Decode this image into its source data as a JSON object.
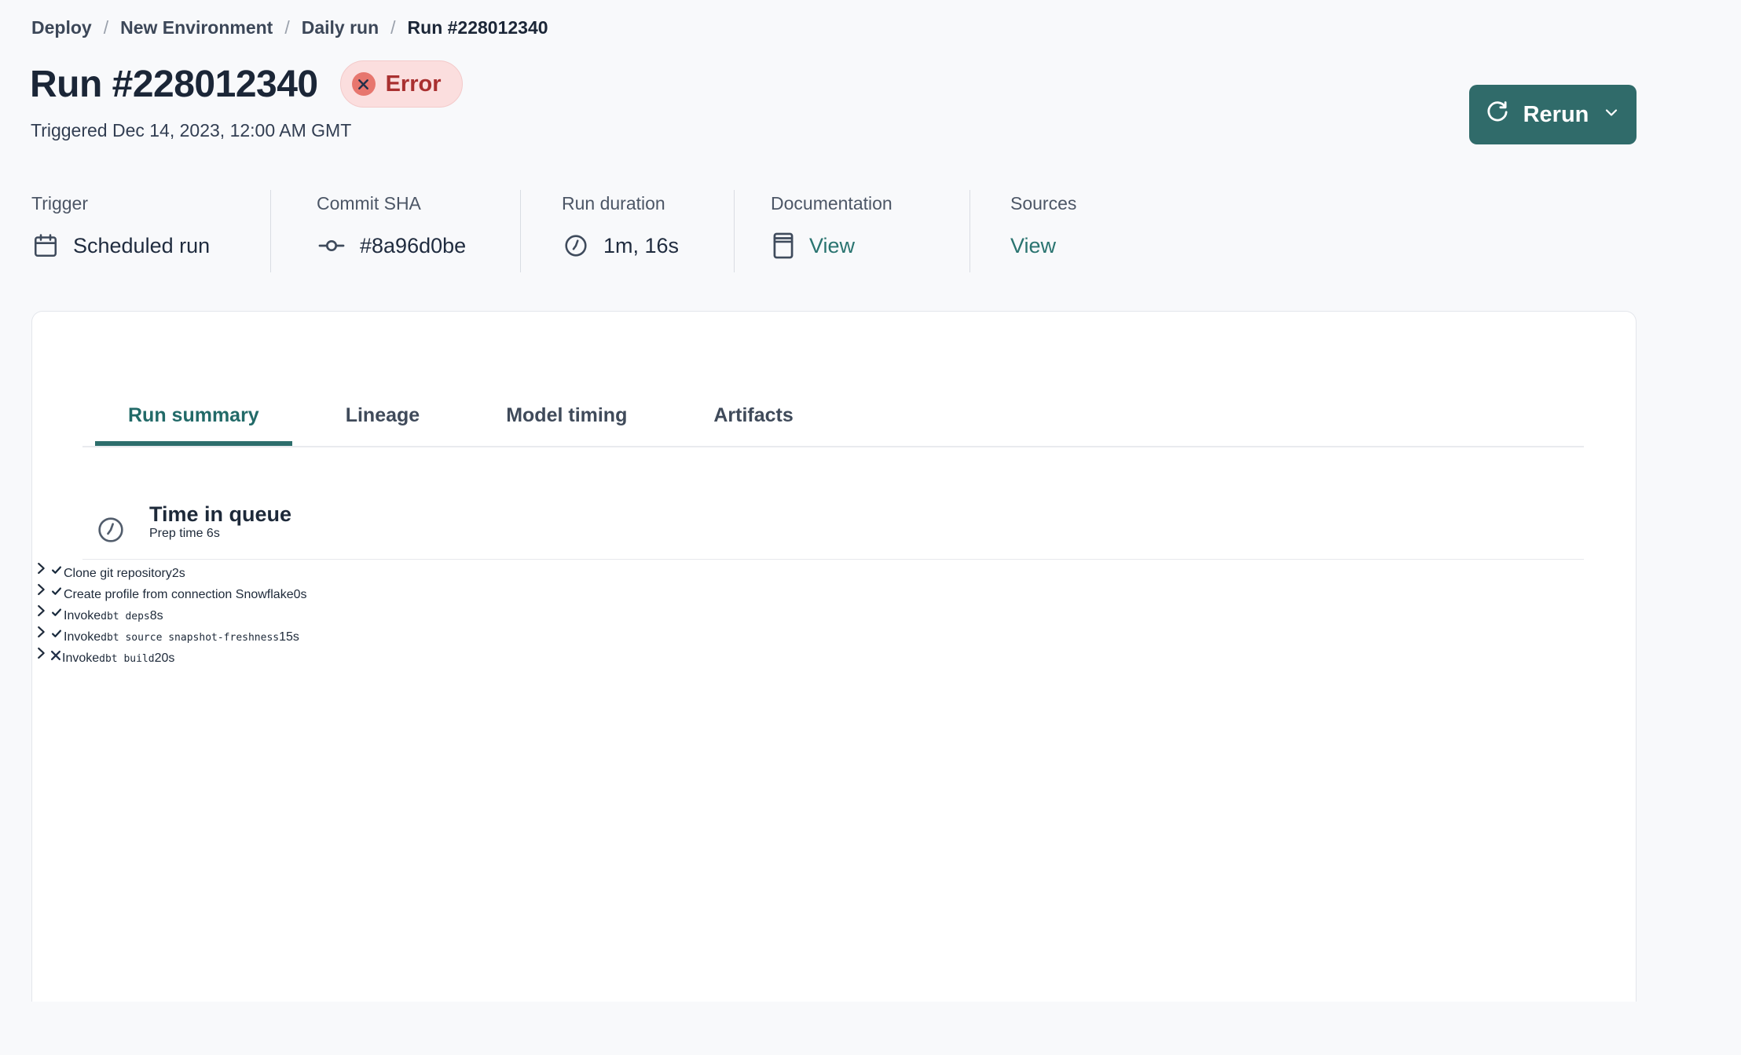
{
  "breadcrumb": {
    "separator": "/",
    "items": [
      "Deploy",
      "New Environment",
      "Daily run",
      "Run #228012340"
    ]
  },
  "header": {
    "title": "Run #228012340",
    "status_badge": {
      "label": "Error",
      "icon": "x-circle-icon"
    },
    "triggered": "Triggered Dec 14, 2023, 12:00 AM GMT",
    "rerun_button": {
      "label": "Rerun",
      "icon": "rotate-icon",
      "chevron_icon": "chevron-down-icon"
    }
  },
  "meta": {
    "columns": [
      {
        "label": "Trigger",
        "value": "Scheduled run",
        "icon": "calendar-icon",
        "link": false
      },
      {
        "label": "Commit SHA",
        "value": "#8a96d0be",
        "icon": "commit-icon",
        "link": false
      },
      {
        "label": "Run duration",
        "value": "1m, 16s",
        "icon": "clock-icon",
        "link": false
      },
      {
        "label": "Documentation",
        "value": "View",
        "icon": "book-icon",
        "link": true
      },
      {
        "label": "Sources",
        "value": "View",
        "icon": null,
        "link": true
      }
    ]
  },
  "tabs": [
    {
      "label": "Run summary",
      "active": true
    },
    {
      "label": "Lineage",
      "active": false
    },
    {
      "label": "Model timing",
      "active": false
    },
    {
      "label": "Artifacts",
      "active": false
    }
  ],
  "queue": {
    "icon": "clock-icon",
    "title": "Time in queue",
    "link": "Prep time 6s"
  },
  "steps": [
    {
      "title": "Clone git repository",
      "code": null,
      "status": "success",
      "duration": "2s"
    },
    {
      "title": "Create profile from connection Snowflake",
      "code": null,
      "status": "success",
      "duration": "0s"
    },
    {
      "title": "Invoke",
      "code": "dbt deps",
      "status": "success",
      "duration": "8s"
    },
    {
      "title": "Invoke",
      "code": "dbt source snapshot-freshness",
      "status": "success",
      "duration": "15s"
    },
    {
      "title": "Invoke",
      "code": "dbt build",
      "status": "error",
      "duration": "20s"
    }
  ],
  "colors": {
    "accent_teal": "#306b6a",
    "link_teal": "#2a7470",
    "success_green": "#60c894",
    "error_red": "#e7766e",
    "error_badge_bg": "#fbdede",
    "error_badge_text": "#a93030",
    "page_bg": "#f8f9fb"
  }
}
